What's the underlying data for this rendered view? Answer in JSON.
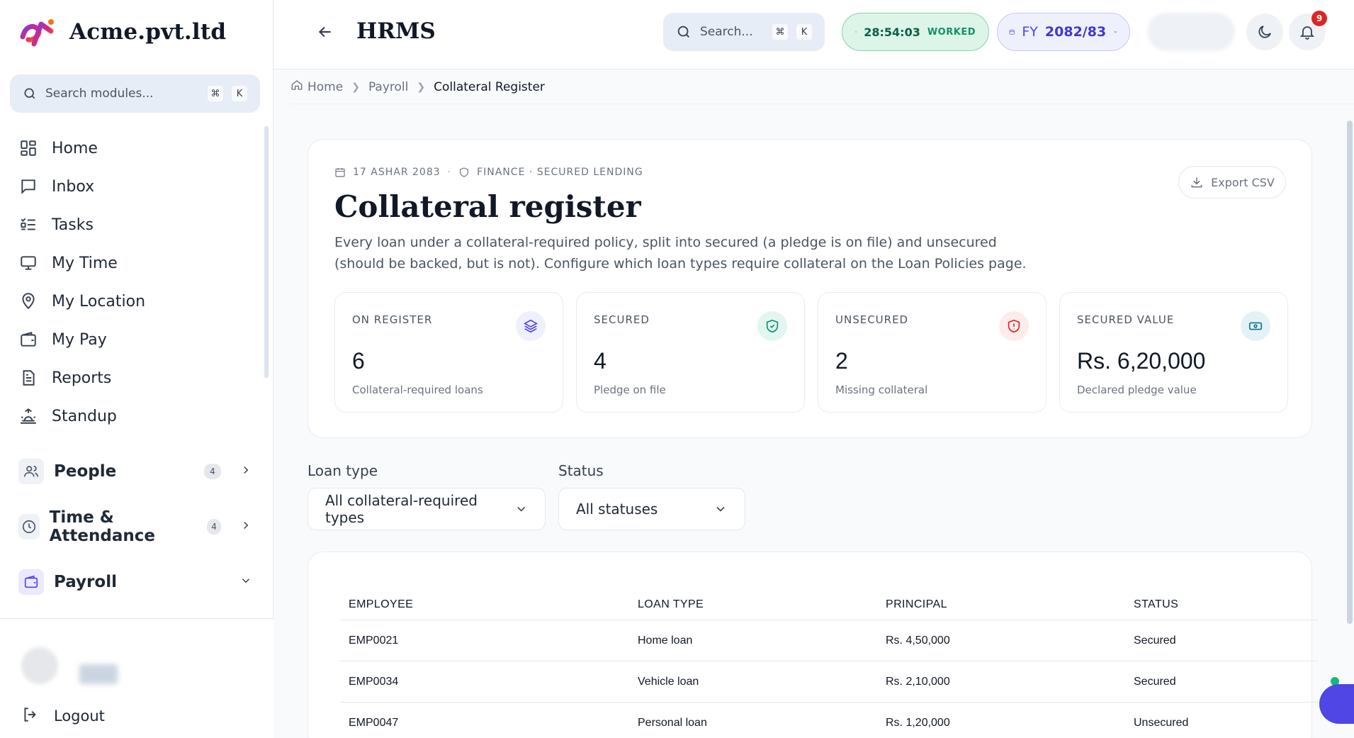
{
  "brand": {
    "name": "Acme.pvt.ltd"
  },
  "sidebar": {
    "search_placeholder": "Search modules...",
    "search_kbd_1": "⌘",
    "search_kbd_2": "K",
    "items": [
      {
        "label": "Home",
        "icon": "grid-icon"
      },
      {
        "label": "Inbox",
        "icon": "message-icon"
      },
      {
        "label": "Tasks",
        "icon": "list-check-icon"
      },
      {
        "label": "My Time",
        "icon": "monitor-icon"
      },
      {
        "label": "My Location",
        "icon": "map-pin-icon"
      },
      {
        "label": "My Pay",
        "icon": "wallet-icon"
      },
      {
        "label": "Reports",
        "icon": "document-icon"
      },
      {
        "label": "Standup",
        "icon": "sunrise-icon"
      }
    ],
    "groups": {
      "people": {
        "label": "People",
        "badge": "4"
      },
      "time": {
        "label": "Time & Attendance",
        "badge": "4"
      },
      "payroll": {
        "label": "Payroll"
      }
    },
    "logout_label": "Logout"
  },
  "header": {
    "title": "HRMS",
    "search_placeholder": "Search...",
    "kbd_1": "⌘",
    "kbd_2": "K",
    "timer_value": "28:54:03",
    "timer_label": "WORKED",
    "fy_prefix": "FY",
    "fy_value": "2082/83",
    "notification_count": "9"
  },
  "breadcrumb": {
    "home": "Home",
    "payroll": "Payroll",
    "current": "Collateral Register"
  },
  "page": {
    "date": "17 ASHAR 2083",
    "category": "FINANCE · SECURED LENDING",
    "title": "Collateral register",
    "description": "Every loan under a collateral-required policy, split into secured (a pledge is on file) and unsecured (should be backed, but is not). Configure which loan types require collateral on the Loan Policies page.",
    "export_label": "Export CSV"
  },
  "stats": [
    {
      "label": "ON REGISTER",
      "value": "6",
      "desc": "Collateral-required loans",
      "icon": "layers-icon",
      "color": "#4f46e5",
      "bg": "#eef0fc"
    },
    {
      "label": "SECURED",
      "value": "4",
      "desc": "Pledge on file",
      "icon": "shield-check-icon",
      "color": "#059669",
      "bg": "#e3f6ee"
    },
    {
      "label": "UNSECURED",
      "value": "2",
      "desc": "Missing collateral",
      "icon": "shield-alert-icon",
      "color": "#dc2626",
      "bg": "#fdecec"
    },
    {
      "label": "SECURED VALUE",
      "value": "Rs. 6,20,000",
      "desc": "Declared pledge value",
      "icon": "banknote-icon",
      "color": "#0e7490",
      "bg": "#e4f2f7"
    }
  ],
  "filters": {
    "loan_type_label": "Loan type",
    "loan_type_value": "All collateral-required types",
    "status_label": "Status",
    "status_value": "All statuses"
  },
  "table": {
    "headers": [
      "EMPLOYEE",
      "LOAN TYPE",
      "PRINCIPAL",
      "STATUS"
    ],
    "rows": [
      [
        "EMP0021",
        "Home loan",
        "Rs. 4,50,000",
        "Secured"
      ],
      [
        "EMP0034",
        "Vehicle loan",
        "Rs. 2,10,000",
        "Secured"
      ],
      [
        "EMP0047",
        "Personal loan",
        "Rs. 1,20,000",
        "Unsecured"
      ]
    ]
  }
}
